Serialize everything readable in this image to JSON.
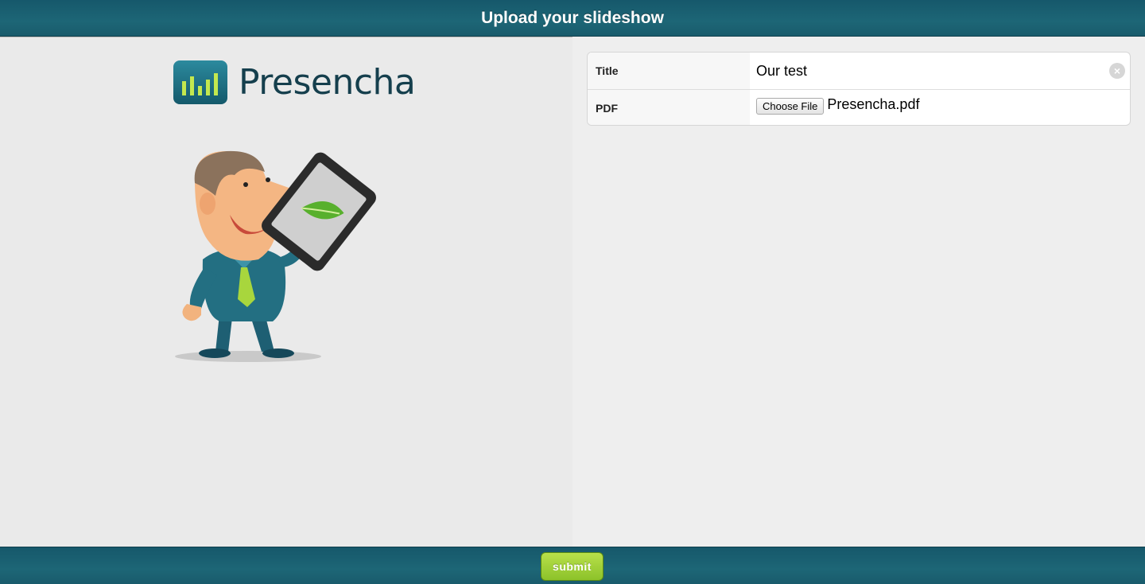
{
  "header": {
    "title": "Upload your slideshow"
  },
  "brand": {
    "name": "Presencha",
    "icon": "bar-chart-logo-icon",
    "color": "#153f4d",
    "icon_color": "#1d6e82",
    "bar_color": "#b8e04a"
  },
  "form": {
    "title_label": "Title",
    "title_value": "Our test",
    "pdf_label": "PDF",
    "choose_file_label": "Choose File",
    "file_name": "Presencha.pdf"
  },
  "footer": {
    "submit_label": "submit",
    "submit_color": "#9bcf34"
  },
  "colors": {
    "bar": "#1d6676",
    "background": "#ececec"
  }
}
